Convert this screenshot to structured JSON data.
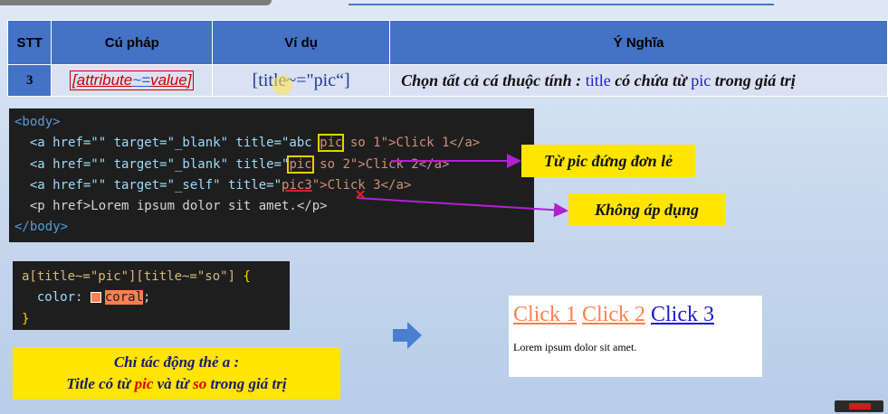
{
  "table": {
    "headers": [
      "STT",
      "Cú pháp",
      "Ví dụ",
      "Ý Nghĩa"
    ],
    "row": {
      "stt": "3",
      "syntax_open": "[",
      "syntax_attr": "attribute",
      "syntax_op": "~=",
      "syntax_val": "value",
      "syntax_close": "]",
      "example": "[title~=\"pic“]",
      "meaning_a": "Chọn tất cả cá thuộc tính : ",
      "meaning_kw1": "title",
      "meaning_b": " có chứa từ ",
      "meaning_kw2": "pic",
      "meaning_c": " trong giá trị"
    }
  },
  "code_html": {
    "l1": "<body>",
    "l2a": "  <a href=\"\" target=\"_blank\" title=\"abc ",
    "l2b": "pic",
    "l2c": " so 1\">Click 1</a>",
    "l3a": "  <a href=\"\" target=\"_blank\" title=\"",
    "l3b": "pic",
    "l3c": " so 2\">Click 2</a>",
    "l4a": "  <a href=\"\" target=\"_self\" title=\"",
    "l4b": "pic3",
    "l4c": "\">Click 3</a>",
    "l5": "  <p href>Lorem ipsum dolor sit amet.</p>",
    "l6": "</body>"
  },
  "code_css": {
    "selector": "a[title~=\"pic\"][title~=\"so\"]",
    "brace_open": " {",
    "prop": "  color: ",
    "value": "coral",
    "semi": ";",
    "brace_close": "}"
  },
  "callouts": {
    "single_word": "Từ pic đứng đơn lẻ",
    "not_applied": "Không áp dụng"
  },
  "note": {
    "line1": "Chỉ tác động thẻ a :",
    "line2a": "Title có từ ",
    "line2b": "pic",
    "line2c": " và từ ",
    "line2d": "so",
    "line2e": " trong giá trị"
  },
  "result": {
    "link1": "Click 1",
    "link2": "Click 2",
    "link3": "Click 3",
    "paragraph": "Lorem ipsum dolor sit amet."
  },
  "colors": {
    "header_bg": "#4472c4",
    "row_bg": "#d9e1f2",
    "callout_bg": "#ffe500",
    "coral": "#ff7f50",
    "arrow_purple": "#b020d0"
  }
}
